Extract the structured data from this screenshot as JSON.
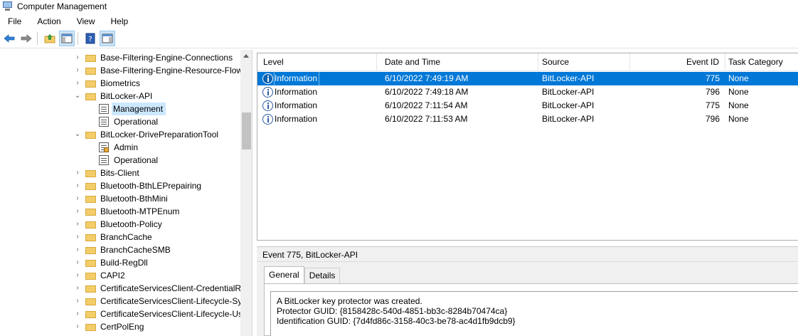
{
  "window": {
    "title": "Computer Management"
  },
  "menu": [
    "File",
    "Action",
    "View",
    "Help"
  ],
  "toolbar": {
    "icons": [
      "back-arrow-icon",
      "forward-arrow-icon",
      "up-folder-icon",
      "show-hide-tree-icon",
      "help-icon",
      "show-hide-action-pane-icon"
    ]
  },
  "tree": {
    "rows": [
      {
        "label": "Base-Filtering-Engine-Connections",
        "type": "folder",
        "chev": "›"
      },
      {
        "label": "Base-Filtering-Engine-Resource-Flow",
        "type": "folder",
        "chev": "›"
      },
      {
        "label": "Biometrics",
        "type": "folder",
        "chev": "›"
      },
      {
        "label": "BitLocker-API",
        "type": "folder",
        "chev": "⌄"
      },
      {
        "label": "Management",
        "type": "log",
        "selected": true
      },
      {
        "label": "Operational",
        "type": "log"
      },
      {
        "label": "BitLocker-DrivePreparationTool",
        "type": "folder",
        "chev": "⌄"
      },
      {
        "label": "Admin",
        "type": "admin-log"
      },
      {
        "label": "Operational",
        "type": "log"
      },
      {
        "label": "Bits-Client",
        "type": "folder",
        "chev": "›"
      },
      {
        "label": "Bluetooth-BthLEPrepairing",
        "type": "folder",
        "chev": "›"
      },
      {
        "label": "Bluetooth-BthMini",
        "type": "folder",
        "chev": "›"
      },
      {
        "label": "Bluetooth-MTPEnum",
        "type": "folder",
        "chev": "›"
      },
      {
        "label": "Bluetooth-Policy",
        "type": "folder",
        "chev": "›"
      },
      {
        "label": "BranchCache",
        "type": "folder",
        "chev": "›"
      },
      {
        "label": "BranchCacheSMB",
        "type": "folder",
        "chev": "›"
      },
      {
        "label": "Build-RegDll",
        "type": "folder",
        "chev": "›"
      },
      {
        "label": "CAPI2",
        "type": "folder",
        "chev": "›"
      },
      {
        "label": "CertificateServicesClient-CredentialRo",
        "type": "folder",
        "chev": "›"
      },
      {
        "label": "CertificateServicesClient-Lifecycle-Sy",
        "type": "folder",
        "chev": "›"
      },
      {
        "label": "CertificateServicesClient-Lifecycle-Us",
        "type": "folder",
        "chev": "›"
      },
      {
        "label": "CertPolEng",
        "type": "folder",
        "chev": "›"
      }
    ]
  },
  "events": {
    "columns": [
      "Level",
      "Date and Time",
      "Source",
      "Event ID",
      "Task Category"
    ],
    "rows": [
      {
        "level": "Information",
        "datetime": "6/10/2022 7:49:19 AM",
        "source": "BitLocker-API",
        "event_id": "775",
        "category": "None",
        "selected": true
      },
      {
        "level": "Information",
        "datetime": "6/10/2022 7:49:18 AM",
        "source": "BitLocker-API",
        "event_id": "796",
        "category": "None"
      },
      {
        "level": "Information",
        "datetime": "6/10/2022 7:11:54 AM",
        "source": "BitLocker-API",
        "event_id": "775",
        "category": "None"
      },
      {
        "level": "Information",
        "datetime": "6/10/2022 7:11:53 AM",
        "source": "BitLocker-API",
        "event_id": "796",
        "category": "None"
      }
    ]
  },
  "detail": {
    "header": "Event 775, BitLocker-API",
    "tabs": [
      "General",
      "Details"
    ],
    "message": [
      "A BitLocker key protector was created.",
      "Protector GUID: {8158428c-540d-4851-bb3c-8284b70474ca}",
      "Identification GUID: {7d4fd86c-3158-40c3-be78-ac4d1fb9dcb9}"
    ]
  },
  "colors": {
    "selection": "#0078d7",
    "tree_selection": "#cce8ff",
    "folder": "#f3cd6a"
  }
}
